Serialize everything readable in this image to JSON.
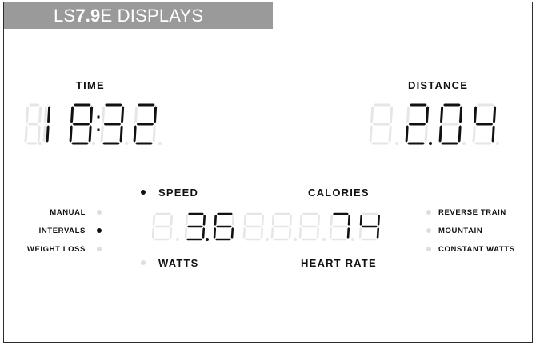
{
  "header": {
    "title_prefix": "LS",
    "title_model": "7.9",
    "title_suffix": "E DISPLAYS"
  },
  "time": {
    "label": "TIME",
    "value": "18:32"
  },
  "distance": {
    "label": "DISTANCE",
    "value": "2.04"
  },
  "speed": {
    "label": "SPEED",
    "value": "3.6",
    "active": true
  },
  "watts": {
    "label": "WATTS",
    "active": false
  },
  "calories": {
    "label": "CALORIES",
    "value": "74"
  },
  "heart_rate": {
    "label": "HEART RATE"
  },
  "programs_left": [
    {
      "label": "MANUAL",
      "active": false
    },
    {
      "label": "INTERVALS",
      "active": true
    },
    {
      "label": "WEIGHT LOSS",
      "active": false
    }
  ],
  "programs_right": [
    {
      "label": "REVERSE TRAIN",
      "active": false
    },
    {
      "label": "MOUNTAIN",
      "active": false
    },
    {
      "label": "CONSTANT WATTS",
      "active": false
    }
  ],
  "colors": {
    "segment_on": "#111111",
    "segment_off": "#e6e6e6",
    "header_bg": "#9a9a9a"
  }
}
